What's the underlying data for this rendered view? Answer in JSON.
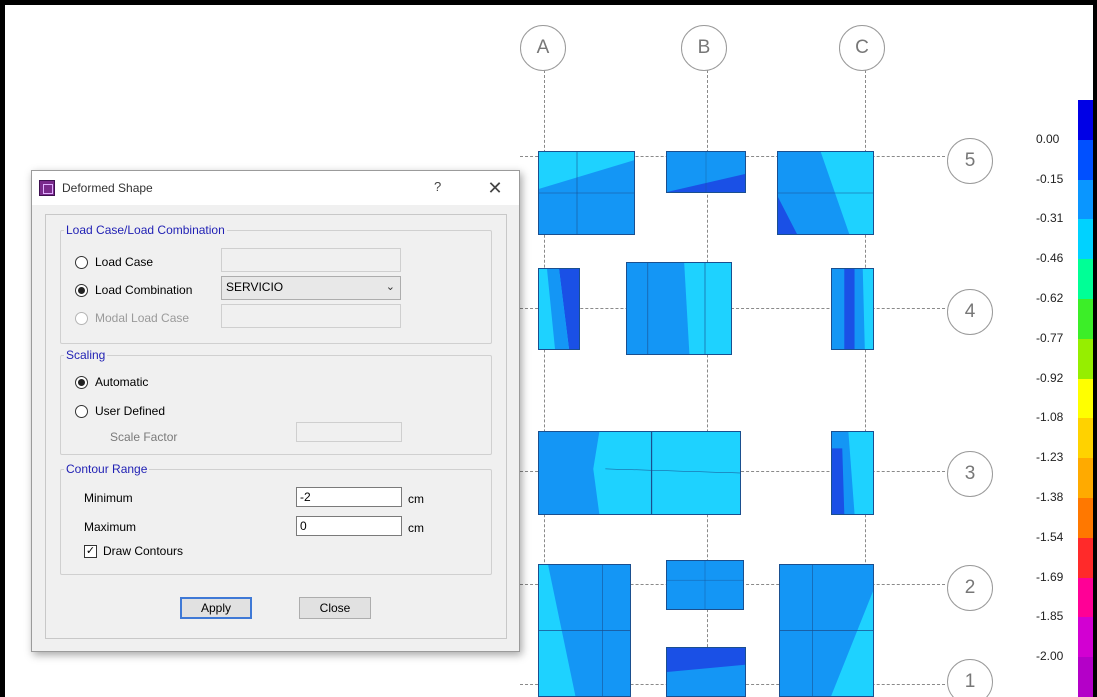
{
  "grid": {
    "columns": [
      "A",
      "B",
      "C"
    ],
    "rows": [
      "5",
      "4",
      "3",
      "2",
      "1"
    ]
  },
  "legend": {
    "labels": [
      "0.00",
      "-0.15",
      "-0.31",
      "-0.46",
      "-0.62",
      "-0.77",
      "-0.92",
      "-1.08",
      "-1.23",
      "-1.38",
      "-1.54",
      "-1.69",
      "-1.85",
      "-2.00"
    ],
    "colors": [
      "#0000e6",
      "#0050ff",
      "#0a96ff",
      "#00d2ff",
      "#00ff96",
      "#3cee28",
      "#96ee00",
      "#ffff00",
      "#ffd200",
      "#ffaa00",
      "#ff7800",
      "#ff2a2a",
      "#ff0096",
      "#d200d2",
      "#b400c8"
    ]
  },
  "colors": {
    "slab_dark": "#1a50e6",
    "slab_mid": "#1496f5",
    "slab_light": "#1ed2ff",
    "slab_cyan": "#00f0ff"
  },
  "dialog": {
    "title": "Deformed Shape",
    "help": "?",
    "close": "✕",
    "load_group": {
      "label": "Load Case/Load Combination",
      "load_case_label": "Load Case",
      "load_combination_label": "Load Combination",
      "load_combination_value": "SERVICIO",
      "modal_load_case_label": "Modal Load Case"
    },
    "scaling": {
      "label": "Scaling",
      "automatic_label": "Automatic",
      "user_defined_label": "User Defined",
      "scale_factor_label": "Scale Factor"
    },
    "contour": {
      "label": "Contour Range",
      "minimum_label": "Minimum",
      "minimum_value": "-2",
      "minimum_unit": "cm",
      "maximum_label": "Maximum",
      "maximum_value": "0",
      "maximum_unit": "cm",
      "draw_contours_label": "Draw Contours"
    },
    "apply_label": "Apply",
    "close_label": "Close"
  }
}
